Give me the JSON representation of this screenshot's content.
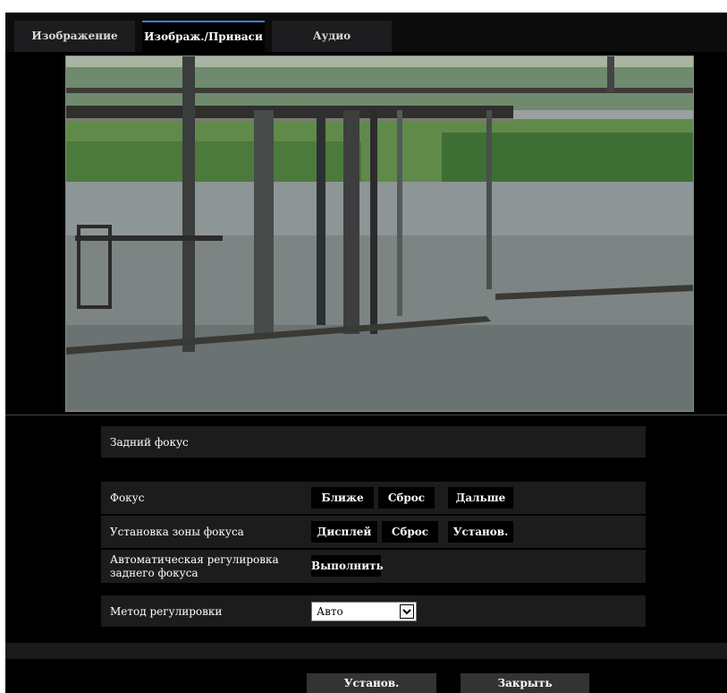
{
  "tabs": [
    {
      "label": "Изображение",
      "active": false
    },
    {
      "label": "Изображ./Приваси",
      "active": true
    },
    {
      "label": "Аудио",
      "active": false
    }
  ],
  "preview": {
    "description_icon": "camera-preview-image"
  },
  "back_focus": {
    "section_title": "Задний фокус",
    "focus": {
      "label": "Фокус",
      "buttons": [
        "Ближе",
        "Сброс",
        "Дальше"
      ]
    },
    "focus_area": {
      "label": "Установка зоны фокуса",
      "buttons": [
        "Дисплей",
        "Сброс",
        "Установ."
      ]
    },
    "auto_adjust": {
      "label_line1": "Автоматическая регулировка",
      "label_line2": "заднего фокуса",
      "button": "Выполнить"
    },
    "method": {
      "label": "Метод регулировки",
      "value": "Авто"
    }
  },
  "footer": {
    "set_label": "Установ.",
    "close_label": "Закрыть"
  },
  "colors": {
    "accent_tab": "#3c7dd3",
    "row_bg": "#1c1c1c",
    "button_bg": "#000000"
  }
}
